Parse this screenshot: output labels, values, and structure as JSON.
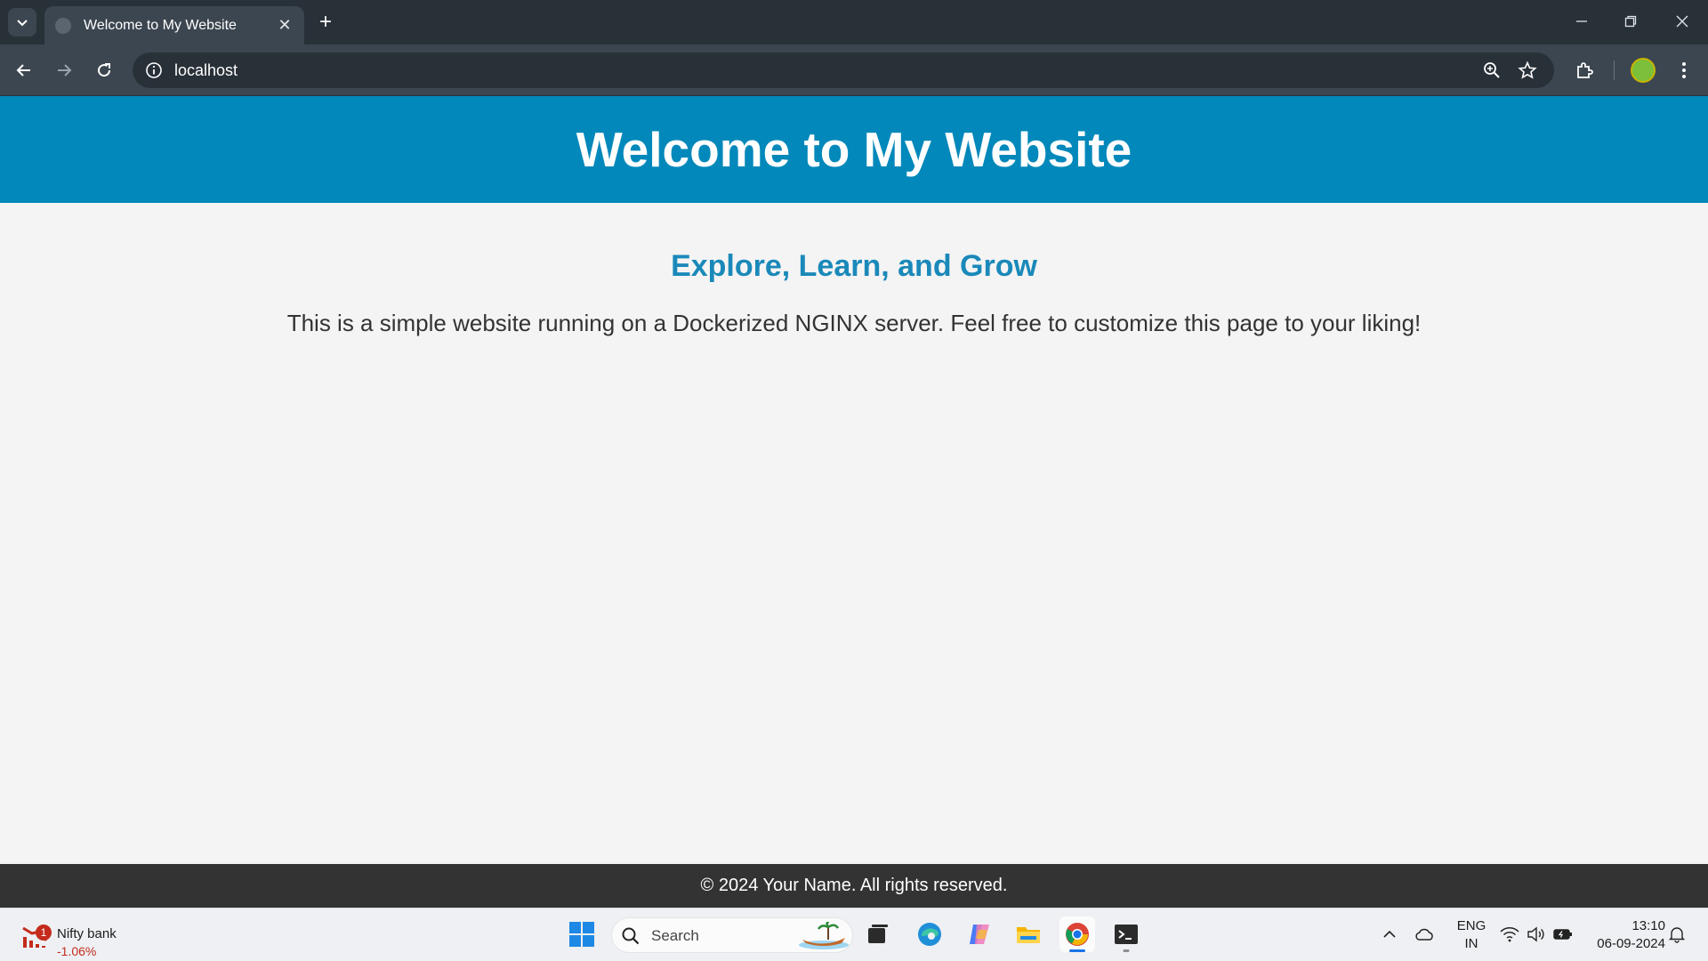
{
  "browser": {
    "tab_title": "Welcome to My Website",
    "new_tab_symbol": "+",
    "close_tab_symbol": "✕",
    "url": "localhost"
  },
  "page": {
    "header_title": "Welcome to My Website",
    "subtitle": "Explore, Learn, and Grow",
    "body_text": "This is a simple website running on a Dockerized NGINX server. Feel free to customize this page to your liking!",
    "footer_text": "© 2024 Your Name. All rights reserved."
  },
  "taskbar": {
    "widget_badge": "1",
    "widget_title": "Nifty bank",
    "widget_change": "-1.06%",
    "search_placeholder": "Search",
    "lang_line1": "ENG",
    "lang_line2": "IN",
    "time": "13:10",
    "date": "06-09-2024"
  },
  "colors": {
    "header_bg": "#0288ba",
    "subtitle": "#1a89b9",
    "footer_bg": "#333333",
    "chrome_dark": "#283038",
    "chrome_toolbar": "#3c4650",
    "widget_negative": "#c42b1c"
  },
  "icons": [
    "tab-search-icon",
    "favicon-icon",
    "close-icon",
    "plus-icon",
    "minimize-icon",
    "restore-icon",
    "window-close-icon",
    "back-arrow-icon",
    "forward-arrow-icon",
    "reload-icon",
    "info-icon",
    "zoom-icon",
    "star-icon",
    "extensions-icon",
    "profile-avatar-icon",
    "kebab-menu-icon",
    "windows-start-icon",
    "search-icon",
    "task-view-icon",
    "edge-icon",
    "copilot-icon",
    "file-explorer-icon",
    "chrome-icon",
    "terminal-icon",
    "chevron-up-icon",
    "onedrive-icon",
    "wifi-icon",
    "volume-icon",
    "battery-icon",
    "notification-bell-icon"
  ]
}
